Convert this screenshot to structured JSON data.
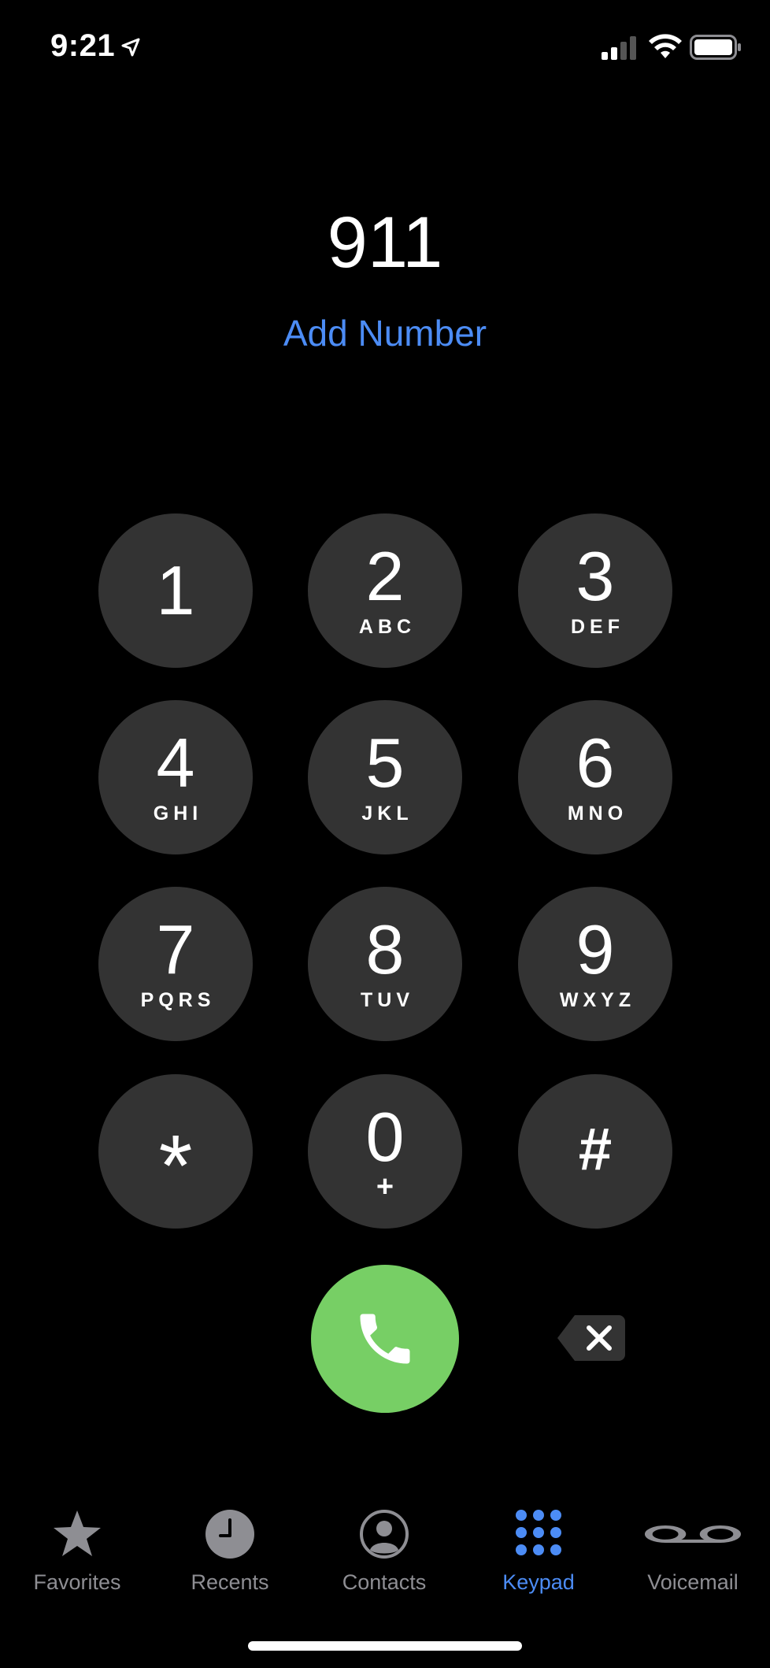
{
  "status_bar": {
    "time": "9:21",
    "icons": [
      "location-arrow-icon",
      "cellular-signal-icon",
      "wifi-icon",
      "battery-icon"
    ]
  },
  "dialer": {
    "number": "911",
    "add_number_label": "Add Number"
  },
  "keypad": {
    "keys": [
      {
        "digit": "1",
        "letters": ""
      },
      {
        "digit": "2",
        "letters": "ABC"
      },
      {
        "digit": "3",
        "letters": "DEF"
      },
      {
        "digit": "4",
        "letters": "GHI"
      },
      {
        "digit": "5",
        "letters": "JKL"
      },
      {
        "digit": "6",
        "letters": "MNO"
      },
      {
        "digit": "7",
        "letters": "PQRS"
      },
      {
        "digit": "8",
        "letters": "TUV"
      },
      {
        "digit": "9",
        "letters": "WXYZ"
      },
      {
        "digit": "*",
        "letters": ""
      },
      {
        "digit": "0",
        "letters": "+"
      },
      {
        "digit": "#",
        "letters": ""
      }
    ]
  },
  "actions": {
    "call_icon": "phone-icon",
    "delete_icon": "delete-backspace-icon"
  },
  "tab_bar": {
    "tabs": [
      {
        "label": "Favorites",
        "icon": "star-icon",
        "active": false
      },
      {
        "label": "Recents",
        "icon": "clock-icon",
        "active": false
      },
      {
        "label": "Contacts",
        "icon": "person-circle-icon",
        "active": false
      },
      {
        "label": "Keypad",
        "icon": "keypad-grid-icon",
        "active": true
      },
      {
        "label": "Voicemail",
        "icon": "voicemail-icon",
        "active": false
      }
    ]
  },
  "colors": {
    "background": "#000000",
    "key_fill": "#333333",
    "accent_blue": "#4c8cf5",
    "call_green": "#77cf65",
    "inactive_gray": "#8e8e93"
  }
}
